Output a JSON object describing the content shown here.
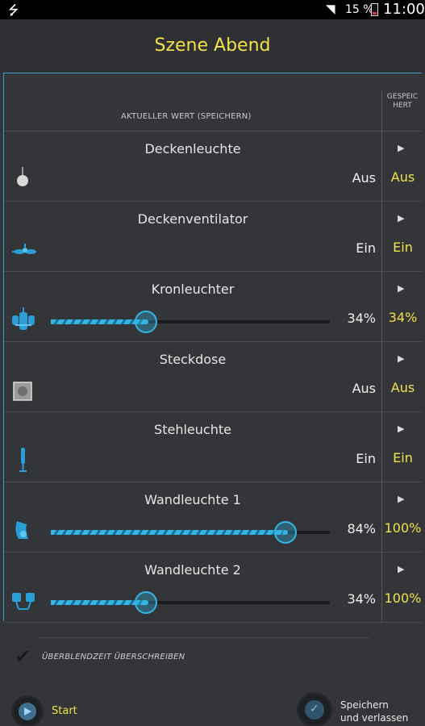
{
  "status_bar": {
    "usb_icon": "usb-icon",
    "wifi_icon": "wifi-icon",
    "battery_text": "15 %",
    "time": "11:00"
  },
  "title": "Szene Abend",
  "header": {
    "current_value": "AKTUELLER WERT (SPEICHERN)",
    "saved": "GESPEICHERT"
  },
  "rows": [
    {
      "name": "Deckenleuchte",
      "value": "Aus",
      "saved": "Aus",
      "icon": "ceiling-lamp-icon"
    },
    {
      "name": "Deckenventilator",
      "value": "Ein",
      "saved": "Ein",
      "icon": "ceiling-fan-icon"
    },
    {
      "name": "Kronleuchter",
      "value": "34%",
      "saved": "34%",
      "icon": "chandelier-icon",
      "level": 0.34
    },
    {
      "name": "Steckdose",
      "value": "Aus",
      "saved": "Aus",
      "icon": "socket-icon"
    },
    {
      "name": "Stehleuchte",
      "value": "Ein",
      "saved": "Ein",
      "icon": "floor-lamp-icon"
    },
    {
      "name": "Wandleuchte 1",
      "value": "84%",
      "saved": "100%",
      "icon": "wall-lamp-icon",
      "level": 0.84
    },
    {
      "name": "Wandleuchte 2",
      "value": "34%",
      "saved": "100%",
      "icon": "wall-lamp-double-icon",
      "level": 0.34
    }
  ],
  "override_label": "ÜBERBLENDZEIT ÜBERSCHREIBEN",
  "start_label": "Start",
  "save_label_line1": "Speichern",
  "save_label_line2": "und verlassen",
  "colors": {
    "accent": "#34b5e5",
    "title": "#f2e24a",
    "background": "#333538"
  }
}
